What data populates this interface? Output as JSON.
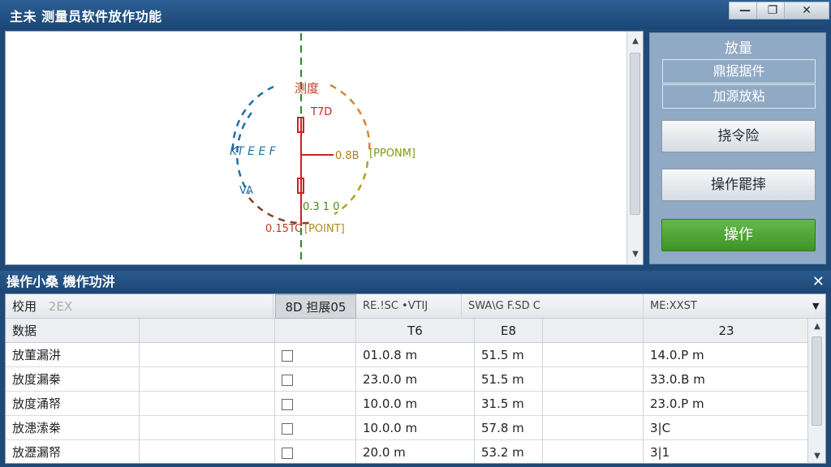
{
  "window": {
    "title": "主未 测量员软件放作功能",
    "minimize_label": "—",
    "restore_label": "❐",
    "close_label": "✕"
  },
  "canvas": {
    "labels": {
      "top": "测度",
      "upper_value": "T7D",
      "left": "KT E E F",
      "left_lower": "VA",
      "right_value": "0.8B",
      "right_tag": "[PPONM]",
      "lower_value": "0.3 1 0",
      "bottom_value": "0.15TC",
      "bottom_tag": "[POINT]"
    },
    "scroll_up": "▲",
    "scroll_down": "▼",
    "colors": {
      "crosshair": "#2e8b2e",
      "measure": "#cc2222",
      "arc_blue": "#1f6fa8",
      "arc_orange": "#d9822b",
      "arc_olive": "#b5a020"
    }
  },
  "right_panel": {
    "title": "放量",
    "box1": "鼎据据件",
    "box2": "加源放粘",
    "btn1": "挠令险",
    "btn2": "操作罷摔",
    "btn_primary": "操作"
  },
  "bottom_panel": {
    "title": "操作小桑 機作功汫",
    "close_label": "✕",
    "header": {
      "c1": "校用",
      "c1_hint": "2EX",
      "c2": "8D 担展05",
      "c3": "RE.!SC •VTIJ",
      "c4": "SWA\\G F.SD C",
      "c5": "ME:XXST",
      "dropdown": "▼"
    },
    "subheader": {
      "c1": "数据",
      "c3": "T6",
      "c4": "E8",
      "c5": "23"
    },
    "rows": [
      {
        "name": "放菫漏汫",
        "v1": "01.0.8 m",
        "v2": "51.5 m",
        "v3": "14.0.P m"
      },
      {
        "name": "放度漏桊",
        "v1": "23.0.0 m",
        "v2": "51.5 m",
        "v3": "33.0.B m"
      },
      {
        "name": "放度涌帑",
        "v1": "10.0.0 m",
        "v2": "31.5 m",
        "v3": "23.0.P m"
      },
      {
        "name": "放漶溹桊",
        "v1": "10.0.0 m",
        "v2": "57.8 m",
        "v3": "3|C"
      },
      {
        "name": "放瀝漏帑",
        "v1": "20.0 m",
        "v2": "53.2 m",
        "v3": "3|1"
      }
    ],
    "scroll_up": "▲",
    "scroll_down": "▼"
  }
}
